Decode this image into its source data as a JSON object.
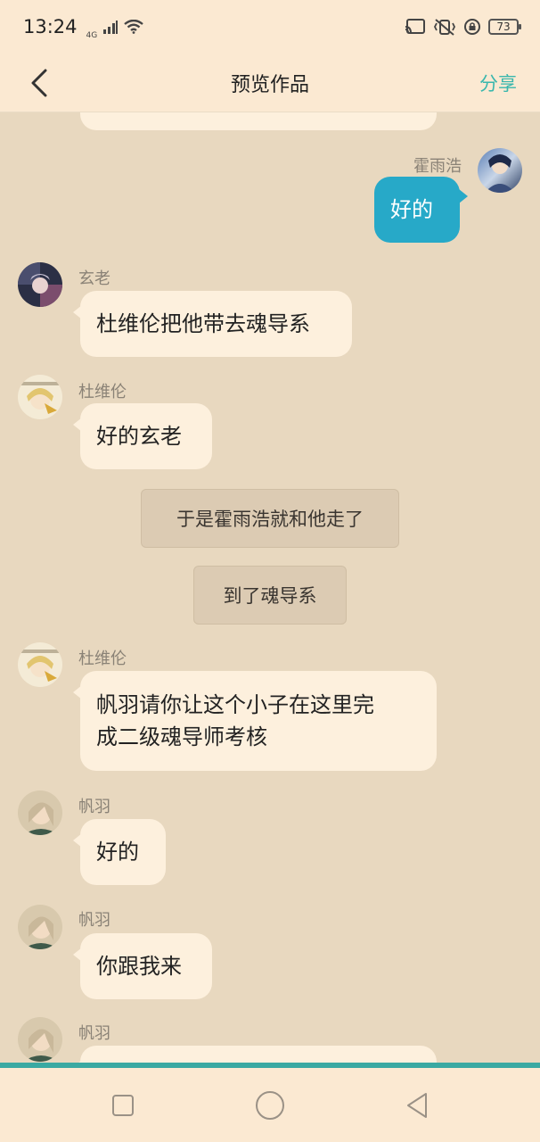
{
  "status": {
    "time": "13:24",
    "network": "4G",
    "battery": "73"
  },
  "header": {
    "title": "预览作品",
    "share": "分享"
  },
  "messages": [
    {
      "sender": "霍雨浩",
      "text": "好的",
      "side": "right"
    },
    {
      "sender": "玄老",
      "text": "杜维伦把他带去魂导系",
      "side": "left"
    },
    {
      "sender": "杜维伦",
      "text": "好的玄老",
      "side": "left"
    },
    {
      "narration": "于是霍雨浩就和他走了"
    },
    {
      "narration": "到了魂导系"
    },
    {
      "sender": "杜维伦",
      "text_line1": "帆羽请你让这个小子在这里完",
      "text_line2": "成二级魂导师考核",
      "side": "left"
    },
    {
      "sender": "帆羽",
      "text": "好的",
      "side": "left"
    },
    {
      "sender": "帆羽",
      "text": "你跟我来",
      "side": "left"
    },
    {
      "sender": "帆羽",
      "text": "",
      "side": "left"
    }
  ],
  "colors": {
    "background": "#e8d8bf",
    "bubble": "#fdf0dd",
    "mine_bubble": "#27a9c8",
    "accent": "#3ab7ad"
  },
  "icons": {
    "back": "chevron-left-icon",
    "nav_square": "square-icon",
    "nav_home": "circle-icon",
    "nav_back": "triangle-back-icon"
  }
}
